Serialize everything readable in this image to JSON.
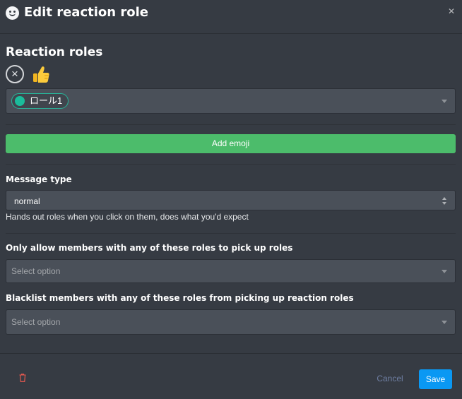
{
  "header": {
    "title": "Edit reaction role",
    "icon": "smiley-icon",
    "close_label": "✕"
  },
  "reaction_roles": {
    "title": "Reaction roles",
    "remove_icon": "close-circle-icon",
    "emoji": "thumbs-up-icon",
    "selected_role": {
      "label": "ロール1",
      "color": "#1bbc9b"
    }
  },
  "add_emoji": {
    "label": "Add emoji",
    "color": "#4cbc6b"
  },
  "message_type": {
    "label": "Message type",
    "value": "normal",
    "help": "Hands out roles when you click on them, does what you'd expect"
  },
  "allow_roles": {
    "label": "Only allow members with any of these roles to pick up roles",
    "placeholder": "Select option"
  },
  "blacklist_roles": {
    "label": "Blacklist members with any of these roles from picking up reaction roles",
    "placeholder": "Select option"
  },
  "footer": {
    "delete_icon": "trash-icon",
    "cancel_label": "Cancel",
    "save_label": "Save",
    "save_color": "#0a98f3"
  }
}
